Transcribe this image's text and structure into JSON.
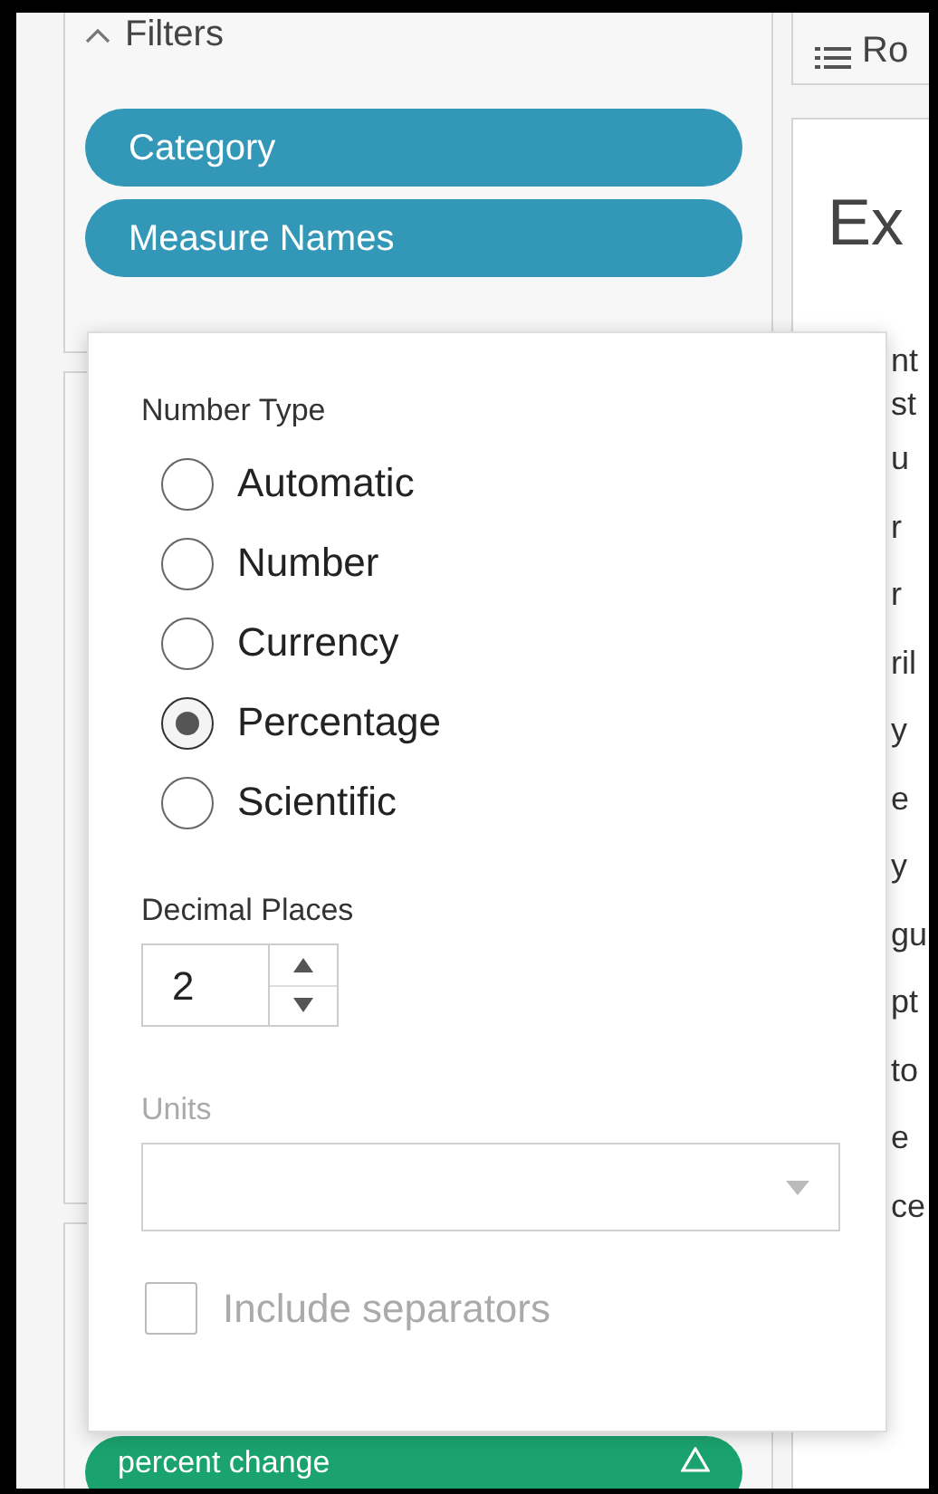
{
  "filters_shelf": {
    "title": "Filters",
    "pills": [
      {
        "label": "Category"
      },
      {
        "label": "Measure Names"
      }
    ]
  },
  "rows_shelf": {
    "title": "Ro"
  },
  "sheet": {
    "title": "Ex",
    "row_fragments": [
      "nt",
      "st",
      "u",
      "r",
      "r",
      "ril",
      "y",
      "e",
      "y",
      "gu",
      "pt",
      "to",
      "e",
      "ce"
    ]
  },
  "marks_pill": {
    "label": "percent change"
  },
  "format_popover": {
    "number_type_label": "Number Type",
    "number_types": [
      {
        "label": "Automatic",
        "selected": false
      },
      {
        "label": "Number",
        "selected": false
      },
      {
        "label": "Currency",
        "selected": false
      },
      {
        "label": "Percentage",
        "selected": true
      },
      {
        "label": "Scientific",
        "selected": false
      }
    ],
    "decimal_places_label": "Decimal Places",
    "decimal_places": "2",
    "units_label": "Units",
    "units_disabled": true,
    "separators": {
      "label": "Include separators",
      "checked": false,
      "disabled": true
    }
  }
}
